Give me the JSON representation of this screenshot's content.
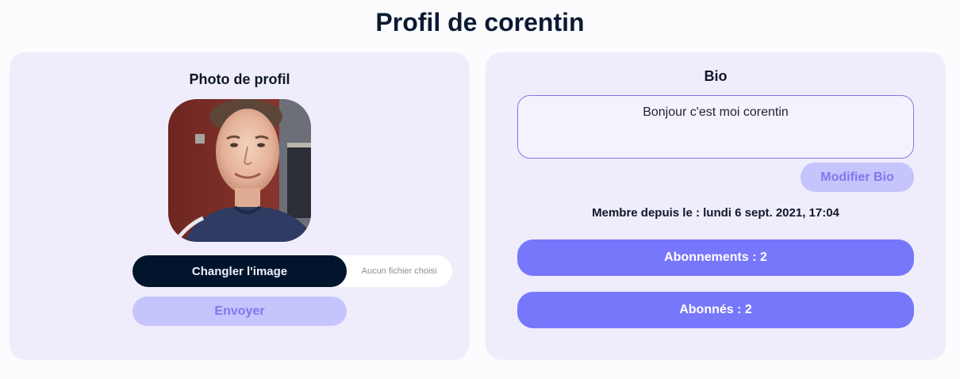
{
  "page": {
    "title": "Profil de corentin"
  },
  "photo_card": {
    "title": "Photo de profil",
    "avatar_alt": "Photo de profil de corentin",
    "change_image_label": "Changler l'image",
    "file_status": "Aucun fichier choisi",
    "send_label": "Envoyer"
  },
  "bio_card": {
    "title": "Bio",
    "bio_text": "Bonjour c'est moi corentin",
    "edit_bio_label": "Modifier Bio",
    "member_since": "Membre depuis le : lundi 6 sept. 2021, 17:04",
    "subscriptions_label": "Abonnements : 2",
    "followers_label": "Abonnés : 2"
  },
  "colors": {
    "background": "#fcfcfe",
    "card_background": "#efedfb",
    "primary_dark": "#00142b",
    "accent": "#7777fb",
    "accent_light": "#c6c4fc",
    "accent_text": "#7b79ee"
  }
}
